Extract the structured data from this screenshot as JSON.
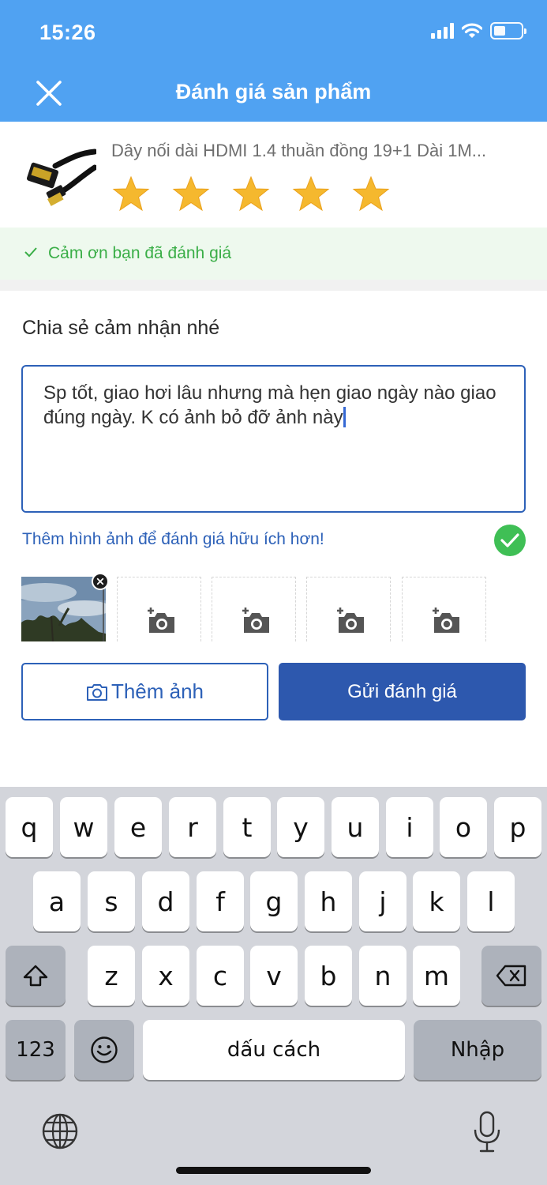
{
  "status_bar": {
    "time": "15:26"
  },
  "header": {
    "title": "Đánh giá sản phẩm",
    "close_icon": "close-icon"
  },
  "product": {
    "name": "Dây nối dài HDMI 1.4 thuần đồng 19+1 Dài 1M...",
    "rating": 5,
    "max_rating": 5,
    "star_color": "#f5a623"
  },
  "thanks": {
    "text": "Cảm ơn bạn đã đánh giá",
    "color": "#3aae47"
  },
  "review": {
    "title": "Chia sẻ cảm nhận nhé",
    "text": "Sp tốt, giao hơi lâu nhưng mà hẹn giao ngày nào giao đúng ngày. K có ảnh bỏ đỡ ảnh này"
  },
  "photos": {
    "hint": "Thêm hình ảnh để đánh giá hữu ích hơn!",
    "uploaded_count": 1,
    "empty_slots": 4
  },
  "buttons": {
    "add_photo": "Thêm ảnh",
    "submit": "Gửi đánh giá"
  },
  "keyboard": {
    "row1": [
      "q",
      "w",
      "e",
      "r",
      "t",
      "y",
      "u",
      "i",
      "o",
      "p"
    ],
    "row2": [
      "a",
      "s",
      "d",
      "f",
      "g",
      "h",
      "j",
      "k",
      "l"
    ],
    "row3": [
      "z",
      "x",
      "c",
      "v",
      "b",
      "n",
      "m"
    ],
    "numbers_key": "123",
    "space_key": "dấu cách",
    "return_key": "Nhập"
  },
  "colors": {
    "header": "#50a2f2",
    "accent": "#2d61b8",
    "submit": "#2d58ae"
  }
}
